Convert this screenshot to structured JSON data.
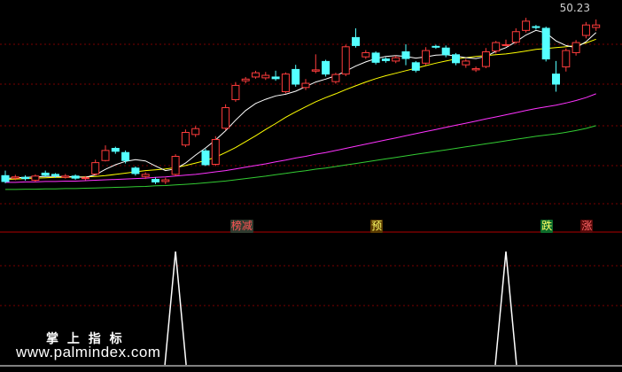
{
  "chart_data": {
    "type": "candlestick",
    "price_label": "50.23",
    "candles": [
      [
        13.0,
        11.6,
        14.2,
        11.2
      ],
      [
        12.4,
        12.7,
        13.2,
        11.9
      ],
      [
        12.6,
        12.3,
        13.1,
        11.8
      ],
      [
        11.9,
        12.9,
        13.3,
        11.5
      ],
      [
        13.6,
        13.1,
        14.2,
        12.7
      ],
      [
        13.3,
        13.0,
        13.6,
        12.5
      ],
      [
        12.6,
        12.9,
        13.4,
        12.3
      ],
      [
        12.9,
        12.4,
        13.3,
        12.0
      ],
      [
        12.3,
        12.5,
        12.9,
        11.9
      ],
      [
        13.4,
        16.1,
        16.8,
        13.0
      ],
      [
        16.6,
        19.0,
        20.2,
        16.4
      ],
      [
        19.5,
        18.8,
        19.9,
        18.2
      ],
      [
        18.5,
        16.6,
        19.0,
        15.9
      ],
      [
        14.8,
        13.5,
        15.2,
        13.0
      ],
      [
        12.8,
        13.3,
        13.8,
        12.2
      ],
      [
        12.1,
        11.5,
        12.6,
        11.0
      ],
      [
        11.6,
        12.0,
        12.5,
        11.0
      ],
      [
        13.3,
        17.6,
        18.1,
        12.9
      ],
      [
        20.3,
        23.3,
        24.0,
        19.8
      ],
      [
        22.8,
        24.2,
        24.8,
        22.2
      ],
      [
        18.9,
        15.6,
        19.4,
        15.3
      ],
      [
        15.7,
        21.6,
        22.4,
        15.3
      ],
      [
        24.3,
        29.2,
        30.0,
        23.8
      ],
      [
        31.1,
        34.5,
        35.3,
        30.6
      ],
      [
        35.6,
        36.0,
        36.5,
        35.0
      ],
      [
        36.5,
        37.5,
        38.0,
        36.1
      ],
      [
        36.3,
        36.9,
        37.7,
        35.8
      ],
      [
        36.5,
        36.1,
        38.0,
        35.6
      ],
      [
        33.0,
        37.2,
        37.6,
        32.6
      ],
      [
        38.3,
        34.8,
        39.4,
        34.2
      ],
      [
        34.0,
        35.0,
        36.0,
        33.4
      ],
      [
        37.9,
        38.2,
        41.9,
        37.4
      ],
      [
        40.2,
        37.2,
        40.6,
        36.6
      ],
      [
        35.4,
        37.1,
        37.5,
        34.9
      ],
      [
        37.2,
        43.7,
        44.2,
        36.7
      ],
      [
        45.9,
        44.0,
        48.1,
        43.5
      ],
      [
        41.3,
        42.3,
        42.9,
        40.8
      ],
      [
        42.2,
        40.0,
        42.6,
        39.5
      ],
      [
        40.8,
        40.4,
        41.2,
        39.9
      ],
      [
        40.3,
        41.1,
        41.6,
        39.8
      ],
      [
        42.5,
        40.9,
        44.3,
        39.3
      ],
      [
        39.9,
        38.1,
        40.3,
        37.6
      ],
      [
        39.8,
        42.8,
        43.6,
        39.3
      ],
      [
        43.8,
        43.6,
        44.2,
        43.2
      ],
      [
        43.4,
        41.8,
        44.0,
        41.2
      ],
      [
        41.8,
        39.9,
        42.2,
        39.3
      ],
      [
        39.4,
        40.3,
        40.8,
        38.7
      ],
      [
        38.2,
        38.5,
        39.0,
        37.7
      ],
      [
        39.0,
        42.5,
        43.4,
        38.6
      ],
      [
        42.7,
        44.7,
        45.1,
        42.1
      ],
      [
        44.2,
        44.2,
        45.4,
        43.8
      ],
      [
        44.8,
        47.3,
        48.1,
        44.4
      ],
      [
        47.6,
        49.8,
        50.6,
        47.1
      ],
      [
        48.5,
        48.3,
        48.9,
        47.8
      ],
      [
        48.1,
        40.8,
        48.5,
        40.2
      ],
      [
        37.2,
        34.8,
        40.3,
        33.0
      ],
      [
        38.9,
        42.8,
        43.3,
        37.8
      ],
      [
        42.3,
        44.7,
        45.3,
        41.6
      ],
      [
        46.4,
        48.9,
        49.6,
        45.7
      ],
      [
        48.3,
        48.9,
        50.2,
        47.5
      ]
    ],
    "ma5": [
      12.3,
      12.5,
      12.6,
      12.7,
      12.8,
      12.8,
      12.8,
      12.7,
      12.6,
      13.2,
      14.5,
      15.6,
      16.4,
      16.8,
      16.5,
      15.3,
      14.2,
      14.6,
      16.0,
      17.9,
      19.6,
      21.5,
      23.7,
      26.2,
      28.5,
      30.2,
      31.2,
      32.0,
      32.4,
      33.1,
      34.2,
      35.3,
      36.0,
      36.8,
      37.9,
      39.1,
      40.1,
      40.9,
      41.4,
      41.6,
      41.4,
      41.0,
      41.3,
      41.7,
      41.8,
      41.5,
      41.1,
      40.9,
      41.4,
      42.6,
      43.5,
      44.9,
      46.5,
      47.6,
      47.0,
      45.1,
      44.0,
      43.5,
      44.9,
      47.1
    ],
    "ma10": [
      12.1,
      12.2,
      12.3,
      12.4,
      12.5,
      12.6,
      12.6,
      12.7,
      12.7,
      12.8,
      13.0,
      13.3,
      13.6,
      13.9,
      14.2,
      14.4,
      14.6,
      14.9,
      15.4,
      16.0,
      16.6,
      17.4,
      18.5,
      19.7,
      21.1,
      22.5,
      24.0,
      25.4,
      26.9,
      28.2,
      29.4,
      30.6,
      31.6,
      32.5,
      33.5,
      34.4,
      35.3,
      36.1,
      36.8,
      37.4,
      38.0,
      38.6,
      39.2,
      39.8,
      40.3,
      40.8,
      41.1,
      41.4,
      41.6,
      41.8,
      42.0,
      42.3,
      42.7,
      43.1,
      43.3,
      43.5,
      43.7,
      44.0,
      44.6,
      45.5
    ],
    "ma30": [
      11.4,
      11.4,
      11.5,
      11.5,
      11.6,
      11.6,
      11.7,
      11.7,
      11.8,
      11.9,
      12.0,
      12.1,
      12.2,
      12.3,
      12.4,
      12.6,
      12.7,
      12.9,
      13.1,
      13.3,
      13.6,
      13.9,
      14.2,
      14.6,
      15.0,
      15.4,
      15.8,
      16.3,
      16.7,
      17.2,
      17.6,
      18.1,
      18.5,
      19.0,
      19.5,
      20.0,
      20.5,
      21.0,
      21.5,
      22.0,
      22.5,
      23.0,
      23.5,
      24.0,
      24.5,
      25.0,
      25.5,
      26.0,
      26.5,
      27.0,
      27.5,
      28.0,
      28.5,
      29.0,
      29.4,
      29.8,
      30.3,
      30.9,
      31.6,
      32.5
    ],
    "signals": [
      {
        "index": 23,
        "label": "榜减",
        "bg": "#2f3b2f",
        "color": "#ff5555"
      },
      {
        "index": 37,
        "label": "预",
        "bg": "#5a3a00",
        "color": "#ffff66"
      },
      {
        "index": 54,
        "label": "跌",
        "bg": "#0d6b2a",
        "color": "#ffff66"
      },
      {
        "index": 58,
        "label": "涨",
        "bg": "#5a0a0a",
        "color": "#ff6666"
      }
    ],
    "indicator_spikes": [
      {
        "index": 17,
        "value": 1
      },
      {
        "index": 50,
        "value": 1
      }
    ],
    "ylim": [
      8,
      54
    ],
    "grid": true
  },
  "watermark": {
    "title": "掌 上 指 标",
    "url": "www.palmindex.com"
  },
  "colors": {
    "up": "#ff3c3c",
    "down": "#54ffff",
    "ma5": "#ffffff",
    "ma10": "#ffff00",
    "ma30": "#ff33ff",
    "ma60": "#33cc33",
    "grid": "#7a0000",
    "divider": "#b00000",
    "spike": "#ffffff"
  }
}
